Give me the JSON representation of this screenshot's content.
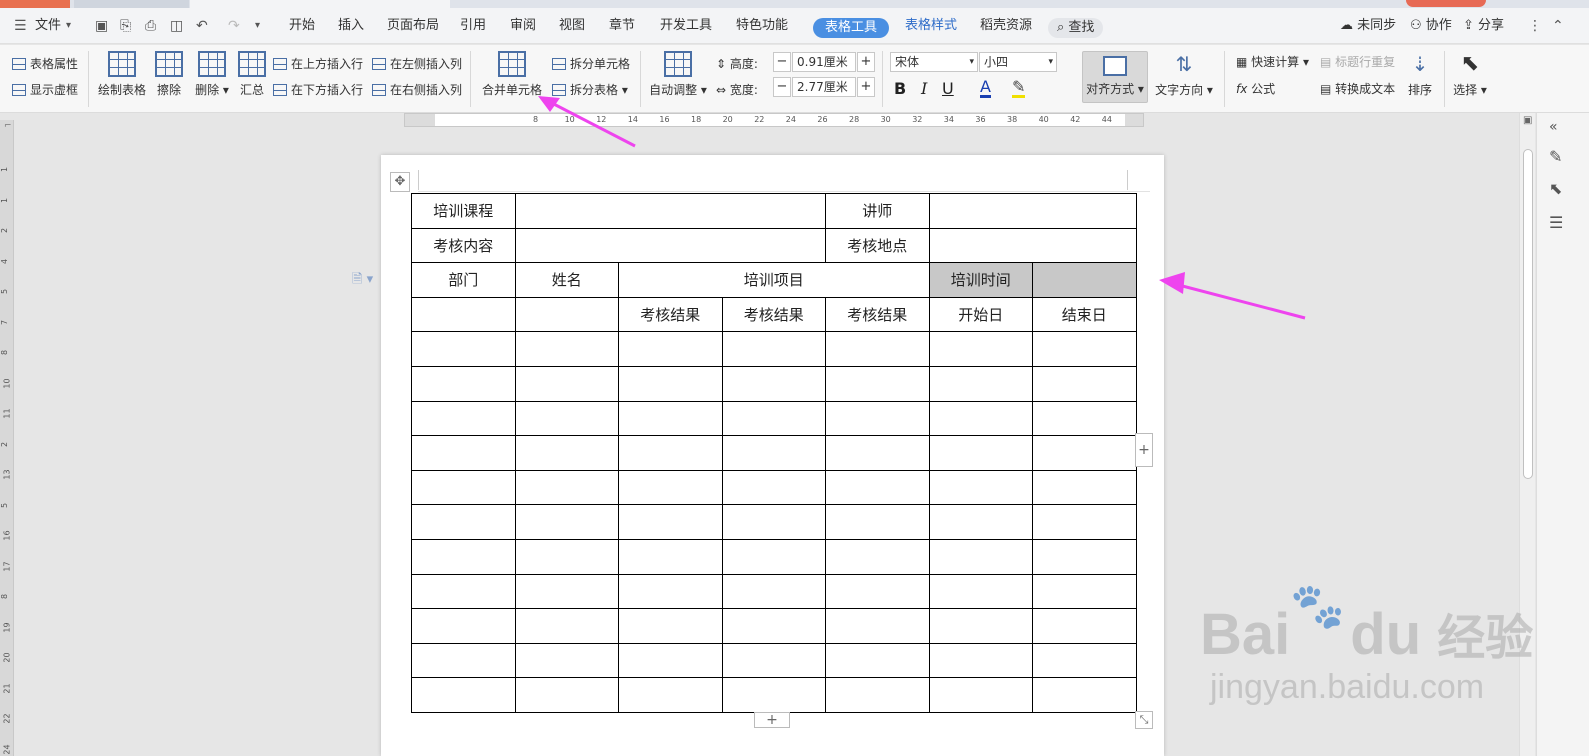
{
  "menu": {
    "file_label": "文件",
    "tabs": [
      "开始",
      "插入",
      "页面布局",
      "引用",
      "审阅",
      "视图",
      "章节",
      "开发工具",
      "特色功能"
    ],
    "active_tab": "表格工具",
    "table_style_tab": "表格样式",
    "shell_tab": "稻壳资源",
    "search_label": "查找",
    "sync_label": "未同步",
    "collab_label": "协作",
    "share_label": "分享"
  },
  "ribbon": {
    "table_props": "表格属性",
    "show_gridlines": "显示虚框",
    "draw_table": "绘制表格",
    "erase": "擦除",
    "delete": "删除",
    "summary": "汇总",
    "insert_above": "在上方插入行",
    "insert_below": "在下方插入行",
    "insert_left": "在左侧插入列",
    "insert_right": "在右侧插入列",
    "merge_cells": "合并单元格",
    "split_cells": "拆分单元格",
    "split_table": "拆分表格",
    "auto_fit": "自动调整",
    "height_label": "高度:",
    "height_value": "0.91厘米",
    "width_label": "宽度:",
    "width_value": "2.77厘米",
    "font_name": "宋体",
    "font_size": "小四",
    "align": "对齐方式",
    "text_direction": "文字方向",
    "quick_calc": "快速计算",
    "formula": "公式",
    "repeat_header": "标题行重复",
    "convert_text": "转换成文本",
    "sort": "排序",
    "select": "选择"
  },
  "ruler_h": [
    "8",
    "10",
    "12",
    "14",
    "16",
    "18",
    "20",
    "22",
    "24",
    "26",
    "28",
    "30",
    "32",
    "34",
    "36",
    "38",
    "40",
    "42",
    "44"
  ],
  "ruler_v": [
    "1",
    "1",
    "2",
    "4",
    "5",
    "7",
    "8",
    "10",
    "11",
    "2",
    "13",
    "5",
    "16",
    "17",
    "8",
    "19",
    "20",
    "21",
    "22",
    "24"
  ],
  "table": {
    "row1": [
      "培训课程",
      "",
      "讲师",
      ""
    ],
    "row2": [
      "考核内容",
      "",
      "考核地点",
      ""
    ],
    "row3": [
      "部门",
      "姓名",
      "培训项目",
      "培训时间",
      ""
    ],
    "row4": [
      "",
      "",
      "考核结果",
      "考核结果",
      "考核结果",
      "开始日",
      "结束日"
    ]
  },
  "watermark": {
    "brand": "Bai",
    "brand2": "du",
    "cn": "经验",
    "url": "jingyan.baidu.com"
  },
  "colors": {
    "accent": "#4a8fe2",
    "arrow": "#ee44ee",
    "selected_cell": "#c8c8c8"
  }
}
